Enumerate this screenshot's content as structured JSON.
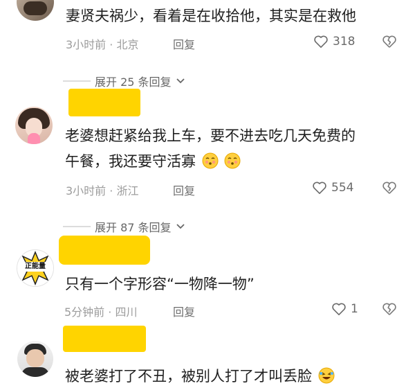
{
  "comments": [
    {
      "text": "妻贤夫祸少，看着是在收拾他，其实是在救他",
      "time": "3小时前 · 北京",
      "reply": "回复",
      "likes": "318"
    },
    {
      "text_line1": "老婆想赶紧给我上车，要不进去吃几天免费的",
      "text_line2": "午餐，我还要守活寡",
      "time": "3小时前 · 浙江",
      "reply": "回复",
      "likes": "554"
    },
    {
      "text": "只有一个字形容“一物降一物”",
      "time": "5分钟前 · 四川",
      "reply": "回复",
      "likes": "1"
    },
    {
      "text": "被老婆打了不丑，被别人打了才叫丢脸"
    }
  ],
  "expand": [
    {
      "label": "展开 25 条回复"
    },
    {
      "label": "展开 87 条回复"
    }
  ],
  "avatar3_text": "正能量",
  "colors": {
    "highlight": "#ffd400",
    "meta": "#9c9c9c",
    "text": "#1f1f1f"
  }
}
